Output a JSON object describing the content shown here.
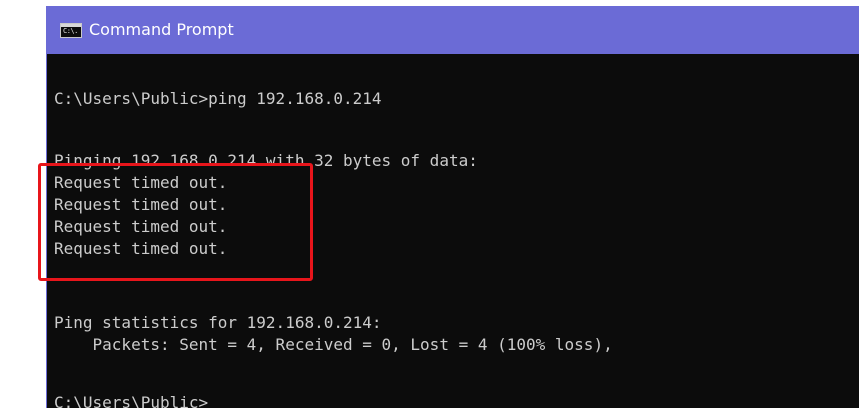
{
  "window": {
    "title": "Command Prompt",
    "icon": "cmd-app-icon",
    "icon_glyph": "C:\\."
  },
  "console": {
    "prompt_command": "C:\\Users\\Public>ping 192.168.0.214",
    "pinging_line": "Pinging 192.168.0.214 with 32 bytes of data:",
    "replies": [
      "Request timed out.",
      "Request timed out.",
      "Request timed out.",
      "Request timed out."
    ],
    "stats_header": "Ping statistics for 192.168.0.214:",
    "stats_packets": "    Packets: Sent = 4, Received = 0, Lost = 4 (100% loss),",
    "prompt_final": "C:\\Users\\Public>"
  },
  "colors": {
    "titlebar": "#6b6bd6",
    "console_bg": "#0c0c0c",
    "console_text": "#cccccc",
    "highlight": "#e8151b"
  }
}
